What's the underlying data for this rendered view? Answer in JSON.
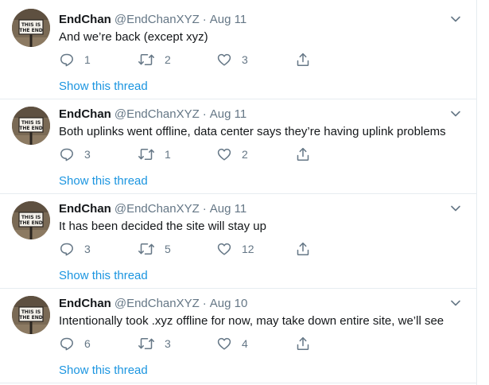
{
  "tweets": [
    {
      "name": "EndChan",
      "handle": "@EndChanXYZ",
      "separator": "·",
      "date": "Aug 11",
      "text": "And we’re back (except xyz)",
      "replies": "1",
      "retweets": "2",
      "likes": "3",
      "show_thread": "Show this thread"
    },
    {
      "name": "EndChan",
      "handle": "@EndChanXYZ",
      "separator": "·",
      "date": "Aug 11",
      "text": "Both uplinks went offline, data center says they’re having uplink problems",
      "replies": "3",
      "retweets": "1",
      "likes": "2",
      "show_thread": "Show this thread"
    },
    {
      "name": "EndChan",
      "handle": "@EndChanXYZ",
      "separator": "·",
      "date": "Aug 11",
      "text": "It has been decided the site will stay up",
      "replies": "3",
      "retweets": "5",
      "likes": "12",
      "show_thread": "Show this thread"
    },
    {
      "name": "EndChan",
      "handle": "@EndChanXYZ",
      "separator": "·",
      "date": "Aug 10",
      "text": "Intentionally took .xyz offline for now, may take down entire site, we’ll see",
      "replies": "6",
      "retweets": "3",
      "likes": "4",
      "show_thread": "Show this thread"
    }
  ],
  "avatar_sign_text": [
    "THIS IS",
    "THE END"
  ],
  "colors": {
    "name": "#14171a",
    "secondary": "#657786",
    "link": "#1b95e0",
    "divider": "#e6ecf0"
  },
  "icons": {
    "reply": "reply-icon",
    "retweet": "retweet-icon",
    "like": "heart-icon",
    "share": "share-icon",
    "more": "chevron-down-icon"
  }
}
